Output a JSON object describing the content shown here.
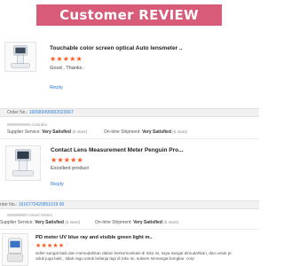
{
  "banner": {
    "title": "Customer REVIEW"
  },
  "reviews": [
    {
      "product_title": "Touchable color screen optical Auto lensmeter ..",
      "stars": "★★★★★",
      "text": "Good , Thanks .",
      "reply_label": "Reply",
      "product_icon": "lensmeter-icon"
    },
    {
      "order_label": "Order No.:",
      "order_number": "166583499002023667",
      "country": "Australia",
      "service_label": "Supplier Service:",
      "service_value": "Very Satisfied",
      "service_note": "(5 stars)",
      "shipment_label": "On-time Shipment:",
      "shipment_value": "Very Satisfied",
      "shipment_note": "(5 stars)",
      "product_title": "Contact Lens Measurement Meter Penguin Pro...",
      "stars": "★★★★★",
      "text": "Excellent product",
      "reply_label": "Reply",
      "product_icon": "lensmeter-icon"
    },
    {
      "order_label": "rder No.:",
      "order_number": "1616772420051019 90",
      "country": "United States",
      "service_label": "Supplier Service:",
      "service_value": "Very Satisfied",
      "service_note": "(5 stars)",
      "shipment_label": "On-time Shipment:",
      "shipment_value": "Very Satisfied",
      "shipment_note": "(5 stars)",
      "product_title": "PD meter UV blue ray and visible green light m..",
      "stars": "★★★★★",
      "text_lines": [
        "seller sangat baik dan memudahkan dalam berkomunikasi di toko ini, saya sangat dimudahkan, dan untuk pr",
        "oduk juga baik , tidak ragu untuk belanja lagi di toko ini, sukses  semangat bongkar. corp"
      ],
      "product_icon": "pd-meter-icon"
    }
  ],
  "colors": {
    "banner": "#d85b7a",
    "stars": "#ff5a1f",
    "link": "#2b7ed9"
  }
}
